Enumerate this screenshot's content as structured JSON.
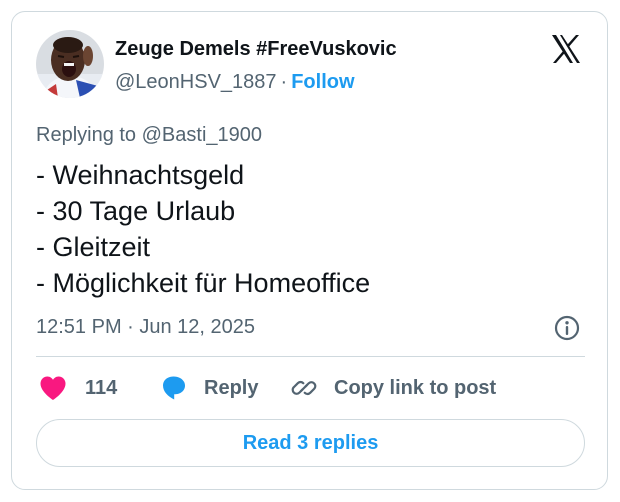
{
  "author": {
    "display_name": "Zeuge Demels #FreeVuskovic",
    "handle": "@LeonHSV_1887",
    "separator": "·",
    "follow_label": "Follow"
  },
  "tweet": {
    "replying_to": "Replying to @Basti_1900",
    "lines": [
      "- Weihnachtsgeld",
      "- 30 Tage Urlaub",
      "- Gleitzeit",
      "- Möglichkeit für Homeoffice"
    ],
    "timestamp": "12:51 PM · Jun 12, 2025"
  },
  "actions": {
    "like_count": "114",
    "reply_label": "Reply",
    "copy_label": "Copy link to post"
  },
  "footer": {
    "read_replies_label": "Read 3 replies"
  },
  "icons": {
    "brand_logo": "x-logo-icon",
    "info": "info-icon",
    "like": "heart-icon",
    "reply": "speech-bubble-icon",
    "copy": "link-icon"
  },
  "colors": {
    "accent": "#1d9bf0",
    "like": "#f91880",
    "secondary_text": "#536471",
    "border": "#cfd9de"
  }
}
